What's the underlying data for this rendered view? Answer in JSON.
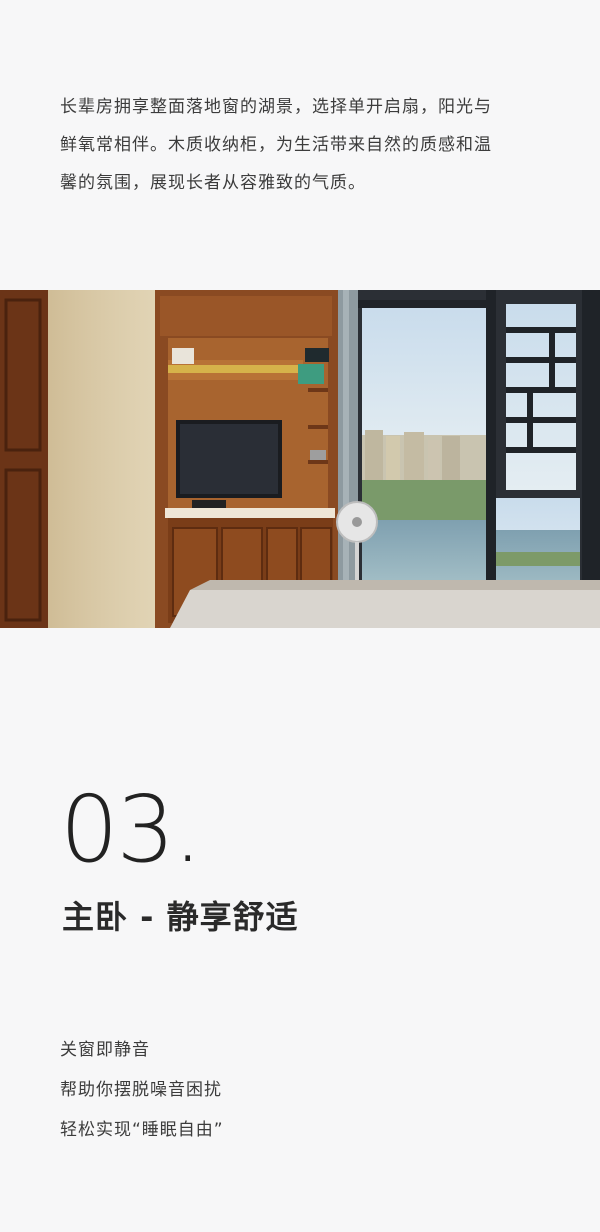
{
  "intro": {
    "lines": [
      "长辈房拥享整面落地窗的湖景，选择单开启扇，阳光与",
      "鲜氧常相伴。木质收纳柜，为生活带来自然的质感和温",
      "馨的氛围，展现长者从容雅致的气质。"
    ]
  },
  "photo": {
    "icon": "bedroom-photo"
  },
  "section": {
    "number": "03.",
    "title": "主卧 - 静享舒适"
  },
  "features": {
    "lines": [
      "关窗即静音",
      "帮助你摆脱噪音困扰",
      "轻松实现“睡眠自由”"
    ]
  },
  "colors": {
    "background": "#f7f7f8",
    "text": "#3c3c3c",
    "wood": "#8a4a22"
  }
}
